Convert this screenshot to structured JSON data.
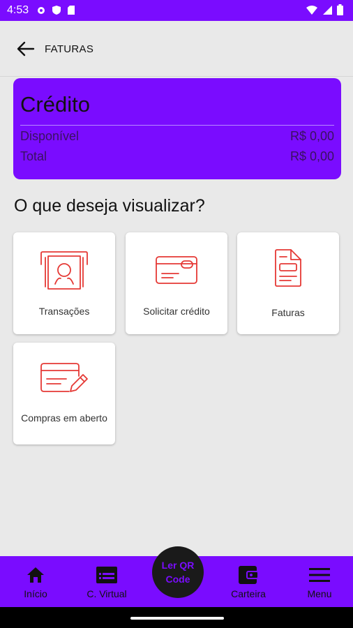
{
  "status_bar": {
    "time": "4:53"
  },
  "header": {
    "title": "FATURAS"
  },
  "credit": {
    "title": "Crédito",
    "rows": [
      {
        "label": "Disponível",
        "value": "R$ 0,00"
      },
      {
        "label": "Total",
        "value": "R$ 0,00"
      }
    ]
  },
  "section": {
    "title": "O que deseja visualizar?"
  },
  "tiles": [
    {
      "label": "Transações",
      "icon": "receipt-icon"
    },
    {
      "label": "Solicitar crédito",
      "icon": "credit-card-icon"
    },
    {
      "label": "Faturas",
      "icon": "invoice-icon"
    },
    {
      "label": "Compras em aberto",
      "icon": "pending-purchase-icon"
    }
  ],
  "bottom_nav": {
    "items": [
      {
        "label": "Início",
        "icon": "home-icon"
      },
      {
        "label": "C. Virtual",
        "icon": "virtual-card-icon"
      },
      {
        "label": "Carteira",
        "icon": "wallet-icon"
      },
      {
        "label": "Menu",
        "icon": "menu-icon"
      }
    ],
    "qr_label": "Ler QR Code"
  },
  "colors": {
    "brand": "#7a0cff",
    "icon_stroke": "#e53935",
    "background": "#e9e9e9"
  }
}
